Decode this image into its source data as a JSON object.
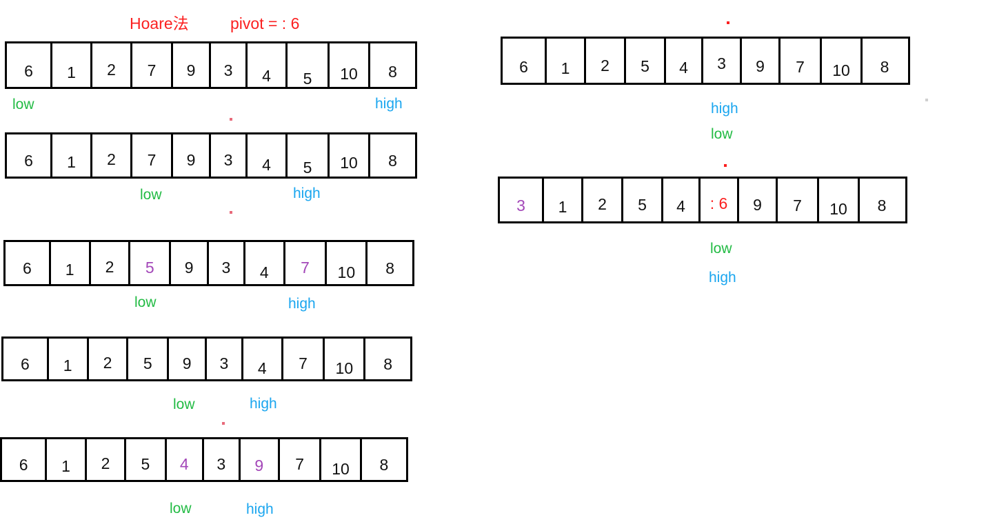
{
  "title": {
    "method": "Hoare法",
    "pivot": "pivot = : 6"
  },
  "colors": {
    "red": "#fb2020",
    "green": "#22bb44",
    "blue": "#1ba6ef",
    "purple": "#a347b8",
    "black": "#111111"
  },
  "pointer_labels": {
    "low": "low",
    "high": "high"
  },
  "arrays": [
    {
      "id": "array-left-1",
      "cells": [
        {
          "value": "6",
          "color": "black"
        },
        {
          "value": "1",
          "color": "black"
        },
        {
          "value": "2",
          "color": "black"
        },
        {
          "value": "7",
          "color": "black"
        },
        {
          "value": "9",
          "color": "black"
        },
        {
          "value": "3",
          "color": "black"
        },
        {
          "value": "4",
          "color": "black"
        },
        {
          "value": "5",
          "color": "black"
        },
        {
          "value": "10",
          "color": "black"
        },
        {
          "value": "8",
          "color": "black"
        }
      ],
      "low_index": 0,
      "high_index": 9
    },
    {
      "id": "array-left-2",
      "cells": [
        {
          "value": "6",
          "color": "black"
        },
        {
          "value": "1",
          "color": "black"
        },
        {
          "value": "2",
          "color": "black"
        },
        {
          "value": "7",
          "color": "black"
        },
        {
          "value": "9",
          "color": "black"
        },
        {
          "value": "3",
          "color": "black"
        },
        {
          "value": "4",
          "color": "black"
        },
        {
          "value": "5",
          "color": "black"
        },
        {
          "value": "10",
          "color": "black"
        },
        {
          "value": "8",
          "color": "black"
        }
      ],
      "low_index": 3,
      "high_index": 7
    },
    {
      "id": "array-left-3",
      "cells": [
        {
          "value": "6",
          "color": "black"
        },
        {
          "value": "1",
          "color": "black"
        },
        {
          "value": "2",
          "color": "black"
        },
        {
          "value": "5",
          "color": "purple"
        },
        {
          "value": "9",
          "color": "black"
        },
        {
          "value": "3",
          "color": "black"
        },
        {
          "value": "4",
          "color": "black"
        },
        {
          "value": "7",
          "color": "purple"
        },
        {
          "value": "10",
          "color": "black"
        },
        {
          "value": "8",
          "color": "black"
        }
      ],
      "low_index": 3,
      "high_index": 7
    },
    {
      "id": "array-left-4",
      "cells": [
        {
          "value": "6",
          "color": "black"
        },
        {
          "value": "1",
          "color": "black"
        },
        {
          "value": "2",
          "color": "black"
        },
        {
          "value": "5",
          "color": "black"
        },
        {
          "value": "9",
          "color": "black"
        },
        {
          "value": "3",
          "color": "black"
        },
        {
          "value": "4",
          "color": "black"
        },
        {
          "value": "7",
          "color": "black"
        },
        {
          "value": "10",
          "color": "black"
        },
        {
          "value": "8",
          "color": "black"
        }
      ],
      "low_index": 4,
      "high_index": 6
    },
    {
      "id": "array-left-5",
      "cells": [
        {
          "value": "6",
          "color": "black"
        },
        {
          "value": "1",
          "color": "black"
        },
        {
          "value": "2",
          "color": "black"
        },
        {
          "value": "5",
          "color": "black"
        },
        {
          "value": "4",
          "color": "purple"
        },
        {
          "value": "3",
          "color": "black"
        },
        {
          "value": "9",
          "color": "purple"
        },
        {
          "value": "7",
          "color": "black"
        },
        {
          "value": "10",
          "color": "black"
        },
        {
          "value": "8",
          "color": "black"
        }
      ],
      "low_index": 4,
      "high_index": 6
    },
    {
      "id": "array-right-1",
      "cells": [
        {
          "value": "6",
          "color": "black"
        },
        {
          "value": "1",
          "color": "black"
        },
        {
          "value": "2",
          "color": "black"
        },
        {
          "value": "5",
          "color": "black"
        },
        {
          "value": "4",
          "color": "black"
        },
        {
          "value": "3",
          "color": "black"
        },
        {
          "value": "9",
          "color": "black"
        },
        {
          "value": "7",
          "color": "black"
        },
        {
          "value": "10",
          "color": "black"
        },
        {
          "value": "8",
          "color": "black"
        }
      ],
      "high_index": 5,
      "low_index": 5
    },
    {
      "id": "array-right-2",
      "cells": [
        {
          "value": "3",
          "color": "purple"
        },
        {
          "value": "1",
          "color": "black"
        },
        {
          "value": "2",
          "color": "black"
        },
        {
          "value": "5",
          "color": "black"
        },
        {
          "value": "4",
          "color": "black"
        },
        {
          "value": ": 6",
          "color": "red"
        },
        {
          "value": "9",
          "color": "black"
        },
        {
          "value": "7",
          "color": "black"
        },
        {
          "value": "10",
          "color": "black"
        },
        {
          "value": "8",
          "color": "black"
        }
      ],
      "low_index": 5,
      "high_index": 5
    }
  ]
}
